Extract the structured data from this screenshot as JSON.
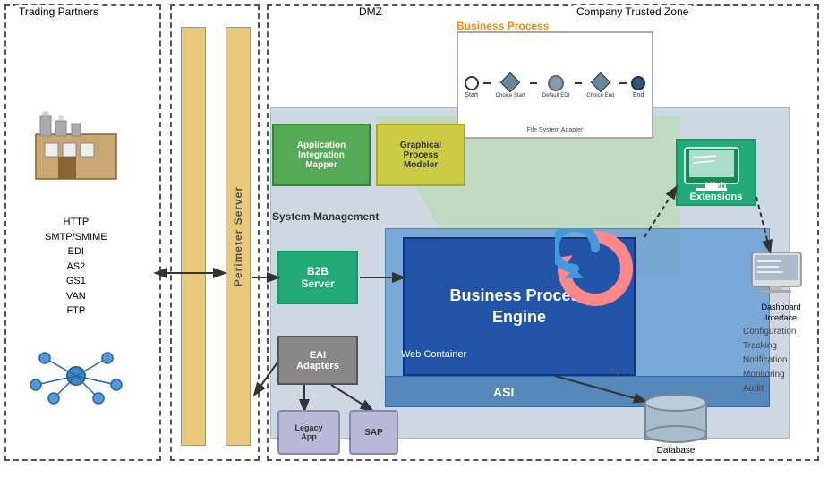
{
  "zones": {
    "trading_partners": "Trading Partners",
    "dmz": "DMZ",
    "trusted": "Company Trusted Zone"
  },
  "perimeter": {
    "label": "Perimeter Server"
  },
  "protocols": {
    "list": [
      "HTTP",
      "SMTP/SMIME",
      "EDI",
      "AS2",
      "GS1",
      "VAN",
      "FTP"
    ]
  },
  "boxes": {
    "b2b": {
      "line1": "B2B",
      "line2": "Server"
    },
    "aim": {
      "line1": "Application",
      "line2": "Integration",
      "line3": "Mapper"
    },
    "gpm": {
      "line1": "Graphical",
      "line2": "Process",
      "line3": "Modeler"
    },
    "bpe": {
      "line1": "Business Process",
      "line2": "Engine"
    },
    "we": {
      "line1": "Web",
      "line2": "Extensions"
    },
    "eai": {
      "line1": "EAI",
      "line2": "Adapters"
    },
    "legacy": {
      "line1": "Legacy",
      "line2": "App"
    },
    "sap": {
      "label": "SAP"
    },
    "database": {
      "label": "Database"
    },
    "web_container": {
      "label": "Web Container"
    },
    "asi": {
      "label": "ASI"
    },
    "system_mgmt": {
      "label": "System Management"
    },
    "business_process": {
      "label": "Business Process"
    },
    "file_system": {
      "label": "File System Adapter"
    },
    "dashboard": {
      "line1": "Dashboard",
      "line2": "Interface"
    }
  },
  "config": {
    "items": [
      "Configuration",
      "Tracking",
      "Notification",
      "Monitoring",
      "Audit"
    ]
  },
  "colors": {
    "green_box": "#22aa77",
    "blue_box": "#2255aa",
    "mid_blue": "#6b9fd4",
    "dark_blue": "#5588bb",
    "olive_box": "#55aa55",
    "yellow_box": "#cccc44",
    "grey_box": "#888888",
    "orange_text": "#ff8800",
    "bg_grey": "#b8c8d8"
  }
}
